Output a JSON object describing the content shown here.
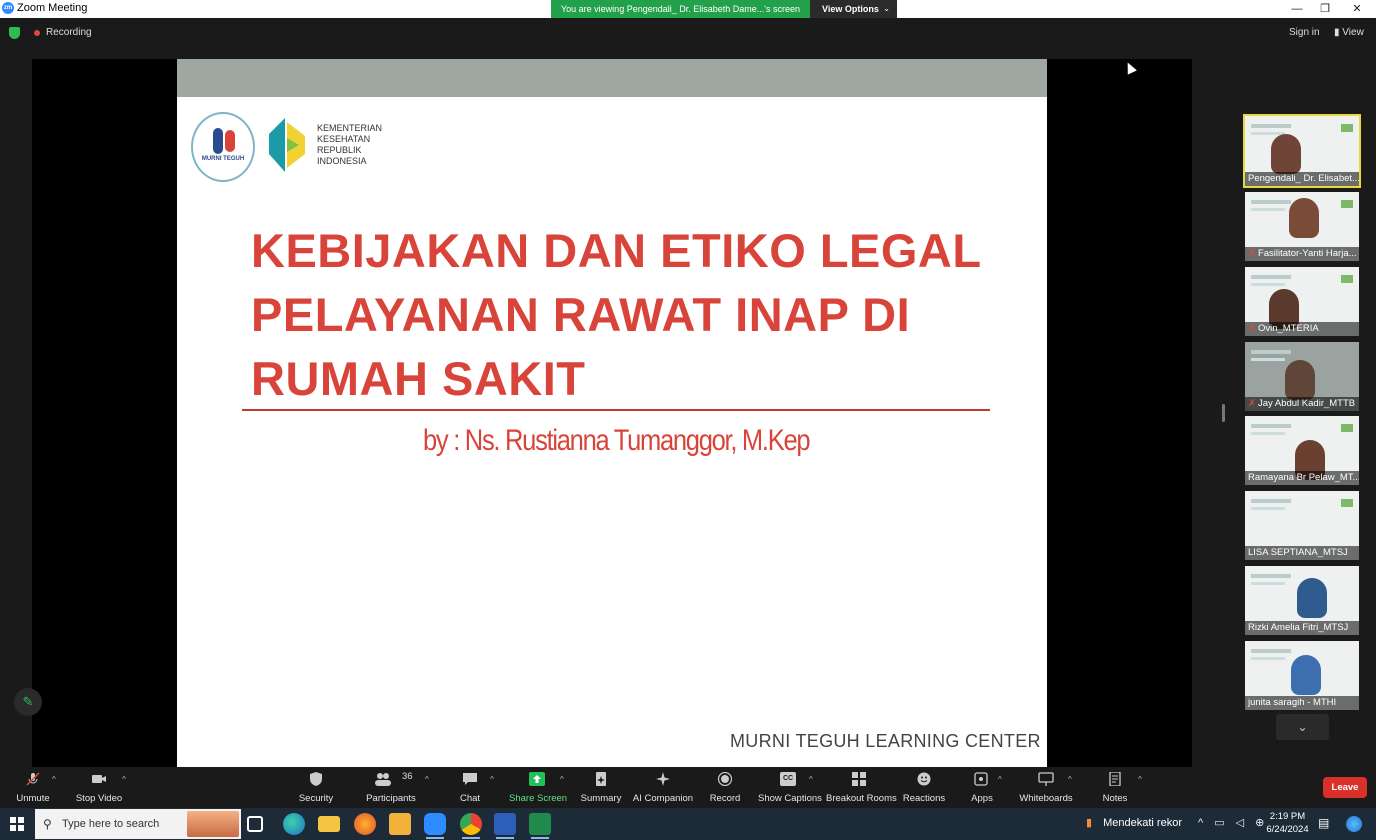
{
  "window": {
    "title": "Zoom Meeting",
    "logo_text": "zm",
    "controls": {
      "minimize": "—",
      "restore": "❐",
      "close": "✕"
    }
  },
  "banner": {
    "viewing_text": "You are viewing Pengendali_ Dr. Elisabeth Dame...'s screen",
    "options_label": "View Options",
    "options_caret": "⌄"
  },
  "statusbar": {
    "recording_label": "Recording",
    "sign_in": "Sign in",
    "view_icon": "▮",
    "view_label": "View"
  },
  "slide": {
    "logo_murni_caption": "MURNI TEGUH",
    "kemenkes_lines": [
      "KEMENTERIAN",
      "KESEHATAN",
      "REPUBLIK",
      "INDONESIA"
    ],
    "title_lines": [
      "KEBIJAKAN DAN ETIKO LEGAL",
      "PELAYANAN RAWAT INAP DI",
      "RUMAH SAKIT"
    ],
    "byline": "by : Ns. Rustianna Tumanggor, M.Kep",
    "footer": "MURNI TEGUH LEARNING CENTER"
  },
  "annotate_icon": "✎",
  "gallery": {
    "participants": [
      {
        "name": "Pengendali_ Dr. Elisabet...",
        "muted": false,
        "active": true
      },
      {
        "name": "Fasilitator-Yanti Harja...",
        "muted": true,
        "active": false
      },
      {
        "name": "Ovin_MTERIA",
        "muted": true,
        "active": false
      },
      {
        "name": "Jay Abdul Kadir_MTTB",
        "muted": true,
        "active": false
      },
      {
        "name": "Ramayana Br Pelaw_MT...",
        "muted": false,
        "active": false
      },
      {
        "name": "LISA SEPTIANA_MTSJ",
        "muted": false,
        "active": false
      },
      {
        "name": "Rizki Amelia Fitri_MTSJ",
        "muted": false,
        "active": false
      },
      {
        "name": "junita saragih - MTHI",
        "muted": false,
        "active": false
      }
    ],
    "mic_muted_icon": "✗",
    "scroll_down_icon": "⌄"
  },
  "toolbar": {
    "unmute": "Unmute",
    "stop_video": "Stop Video",
    "security": "Security",
    "participants": "Participants",
    "participants_count": "36",
    "chat": "Chat",
    "share_screen": "Share Screen",
    "summary": "Summary",
    "ai_companion": "AI Companion",
    "record": "Record",
    "show_captions": "Show Captions",
    "captions_icon_text": "CC",
    "breakout_rooms": "Breakout Rooms",
    "reactions": "Reactions",
    "apps": "Apps",
    "whiteboards": "Whiteboards",
    "notes": "Notes",
    "leave": "Leave",
    "caret": "^"
  },
  "taskbar": {
    "search_placeholder": "Type here to search",
    "search_icon": "⚲",
    "weather_text": "Mendekati rekor",
    "tray_icons": "^ ▭ ◁ ⊕",
    "time": "2:19 PM",
    "date": "6/24/2024",
    "notification_icon": "▤"
  },
  "colors": {
    "title_red": "#d9443a",
    "banner_green": "#23a14a",
    "leave_red": "#d9302c",
    "share_green": "#23c05a",
    "active_tile": "#e8d83a"
  }
}
